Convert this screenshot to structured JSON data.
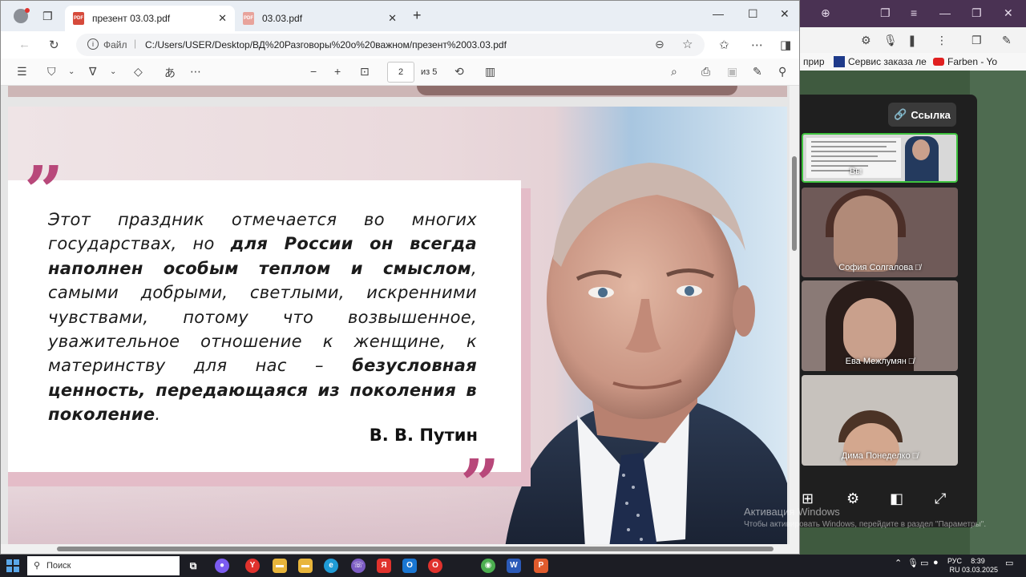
{
  "browser": {
    "tabs": [
      {
        "label": "презент 03.03.pdf",
        "active": true
      },
      {
        "label": "03.03.pdf",
        "active": false
      }
    ],
    "address": {
      "scheme_label": "Файл",
      "url": "C:/Users/USER/Desktop/ВД%20Разговоры%20о%20важном/презент%2003.03.pdf"
    }
  },
  "pdf_toolbar": {
    "current_page": "2",
    "total_pages_label": "из 5",
    "icons": [
      "contents-icon",
      "highlight-icon",
      "draw-icon",
      "eraser-icon",
      "read-aloud-icon",
      "more-icon",
      "zoom-out-icon",
      "zoom-in-icon",
      "fit-page-icon",
      "rotate-icon",
      "page-view-icon",
      "search-icon",
      "print-icon",
      "save-icon",
      "save-as-icon"
    ]
  },
  "slide": {
    "quote_parts": [
      {
        "text": "Этот праздник отмечается во многих государствах, но ",
        "bold": false
      },
      {
        "text": "для России он всегда наполнен особым теплом и смыслом",
        "bold": true
      },
      {
        "text": ", самыми добрыми, светлыми, искренними чувствами, потому что возвышенное, уважительное отношение к женщине, к материнству для нас – ",
        "bold": false
      },
      {
        "text": "безусловная ценность, передающаяся из поколения в поколение",
        "bold": true
      },
      {
        "text": ".",
        "bold": false
      }
    ],
    "author": "В. В. Путин",
    "open_quote": "”",
    "close_quote": "”"
  },
  "second_browser": {
    "bookmarks": [
      "прир",
      "Сервис заказа ле",
      "Farben - Yo"
    ]
  },
  "meeting": {
    "link_button": "Ссылка",
    "self_label": "Вы",
    "participants": [
      "София Солгалова",
      "Ева Межлумян",
      "Дима Понеделко"
    ]
  },
  "windows_activation": {
    "title": "Активация Windows",
    "subtitle": "Чтобы активировать Windows, перейдите в раздел \"Параметры\"."
  },
  "taskbar": {
    "search_placeholder": "Поиск",
    "language": "РУС",
    "language_sub": "RU",
    "time": "8:39",
    "date": "03.03.2025"
  },
  "colors": {
    "accent_quote": "#b8487a",
    "pink_panel": "#e4bcc8",
    "meeting_bg": "#1f1f1f",
    "active_speaker": "#3fc33f"
  }
}
